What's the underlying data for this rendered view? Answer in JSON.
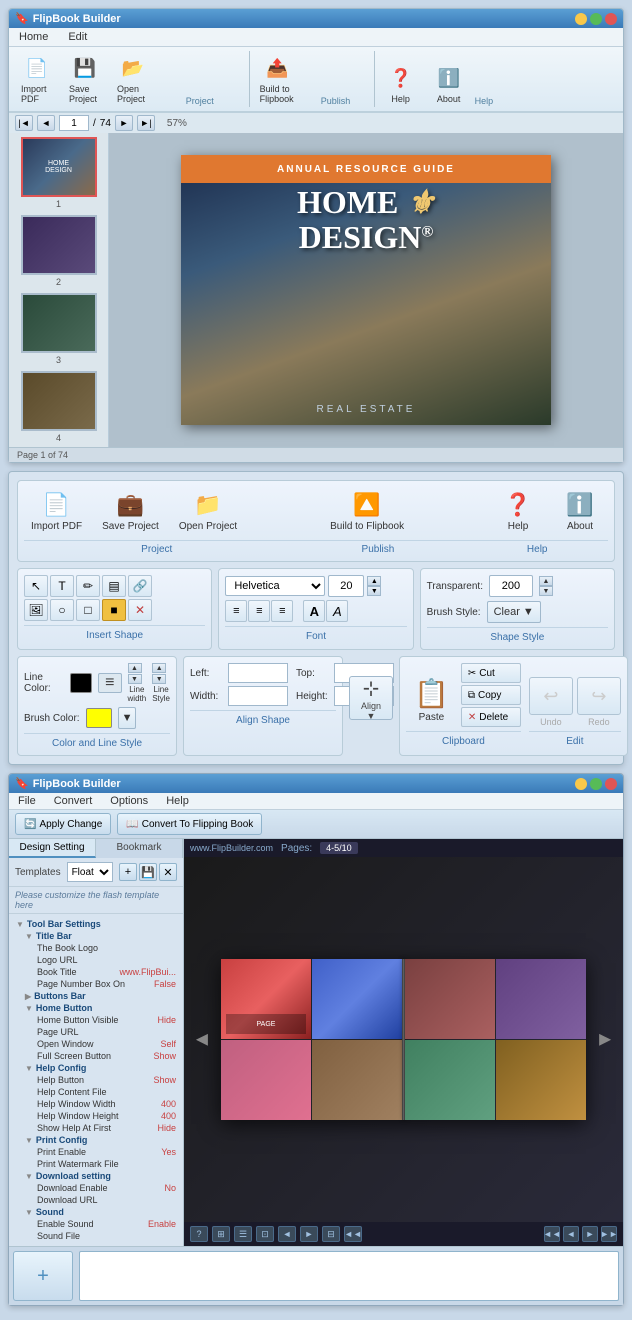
{
  "app": {
    "title": "FlipBook Builder",
    "menus": [
      "Home",
      "Edit"
    ]
  },
  "toolbar": {
    "project": {
      "label": "Project",
      "buttons": [
        {
          "label": "Import PDF",
          "icon": "📄"
        },
        {
          "label": "Save Project",
          "icon": "💾"
        },
        {
          "label": "Open Project",
          "icon": "📂"
        }
      ]
    },
    "publish": {
      "label": "Publish",
      "buttons": [
        {
          "label": "Build to Flipbook",
          "icon": "📤"
        }
      ]
    },
    "help": {
      "label": "Help",
      "buttons": [
        {
          "label": "Help",
          "icon": "❓"
        },
        {
          "label": "About",
          "icon": "ℹ️"
        }
      ]
    }
  },
  "navigation": {
    "current_page": "1",
    "total_pages": "74",
    "status": "Page 1 of 74",
    "zoom": "57%"
  },
  "thumbnails": [
    {
      "num": "1",
      "active": true
    },
    {
      "num": "2",
      "active": false
    },
    {
      "num": "3",
      "active": false
    },
    {
      "num": "4",
      "active": false
    }
  ],
  "cover": {
    "top_bar": "ANNUAL RESOURCE GUIDE",
    "title_line1": "HOME",
    "title_line2": "DESIGN",
    "bottom_text": "REAL ESTATE"
  },
  "section2": {
    "toolbar_groups": {
      "insert_shape": {
        "label": "Insert Shape",
        "tools": [
          "cursor",
          "text",
          "pencil",
          "textbox",
          "link",
          "image",
          "circle",
          "rect",
          "colored-rect",
          "delete-shape"
        ]
      },
      "font": {
        "label": "Font",
        "font_name": "Helvetica",
        "font_size": "20",
        "align_btns": [
          "left",
          "center",
          "right",
          "bold",
          "italic"
        ]
      },
      "shape_style": {
        "label": "Shape Style",
        "transparent_label": "Transparent:",
        "transparent_value": "200",
        "brush_style_label": "Brush Style:",
        "brush_style_value": "Clear"
      }
    },
    "color_style": {
      "label": "Color and Line Style",
      "line_color_label": "Line Color:",
      "brush_color_label": "Brush Color:",
      "line_color": "#000000",
      "brush_color": "#ffff00"
    },
    "align_shape": {
      "label": "Align Shape",
      "left_label": "Left:",
      "top_label": "Top:",
      "width_label": "Width:",
      "height_label": "Height:"
    },
    "clipboard": {
      "label": "Clipboard",
      "paste_label": "Paste",
      "cut_label": "Cut",
      "copy_label": "Copy",
      "delete_label": "Delete"
    },
    "edit": {
      "label": "Edit",
      "undo_label": "Undo",
      "redo_label": "Redo"
    }
  },
  "section3": {
    "title": "FlipBook Builder",
    "menus": [
      "File",
      "Convert",
      "Options",
      "Help"
    ],
    "apply_btn": "Apply Change",
    "convert_btn": "Convert To Flipping Book",
    "tabs": [
      "Design Setting",
      "Bookmark"
    ],
    "templates_label": "Templates",
    "template_value": "Float",
    "customize_text": "Please customize the flash template here",
    "preview_url": "www.FlipBuilder.com",
    "preview_pages": "Pages:",
    "preview_page_num": "4-5/10",
    "tree_items": [
      {
        "label": "Tool Bar Settings",
        "level": 1,
        "expanded": true
      },
      {
        "label": "Title Bar",
        "level": 2,
        "expanded": true
      },
      {
        "label": "The Book Logo",
        "level": 3
      },
      {
        "label": "Logo URL",
        "level": 3
      },
      {
        "label": "Book Title",
        "level": 3,
        "value": "www.FlipBui..."
      },
      {
        "label": "Page Number Box On",
        "level": 3,
        "value": "False"
      },
      {
        "label": "Buttons Bar",
        "level": 2,
        "expanded": false
      },
      {
        "label": "Home Button",
        "level": 2,
        "expanded": true
      },
      {
        "label": "Home Button Visible",
        "level": 3,
        "value": "Hide"
      },
      {
        "label": "Page URL",
        "level": 3
      },
      {
        "label": "Open Window",
        "level": 3,
        "value": "Self"
      },
      {
        "label": "Full Screen Button",
        "level": 3,
        "value": "Show"
      },
      {
        "label": "Help Config",
        "level": 2,
        "expanded": true
      },
      {
        "label": "Help Button",
        "level": 3,
        "value": "Show"
      },
      {
        "label": "Help Content File",
        "level": 3
      },
      {
        "label": "Help Window Width",
        "level": 3,
        "value": "400"
      },
      {
        "label": "Help Window Height",
        "level": 3,
        "value": "400"
      },
      {
        "label": "Show Help At First",
        "level": 3,
        "value": "Hide"
      },
      {
        "label": "Print Config",
        "level": 2,
        "expanded": true
      },
      {
        "label": "Print Enable",
        "level": 3,
        "value": "Yes"
      },
      {
        "label": "Print Watermark File",
        "level": 3
      },
      {
        "label": "Download setting",
        "level": 2,
        "expanded": true
      },
      {
        "label": "Download Enable",
        "level": 3,
        "value": "No"
      },
      {
        "label": "Download URL",
        "level": 3
      },
      {
        "label": "Sound",
        "level": 2,
        "expanded": true
      },
      {
        "label": "Enable Sound",
        "level": 3,
        "value": "Enable"
      },
      {
        "label": "Sound File",
        "level": 3
      }
    ],
    "bottom_tools": [
      "?",
      "⊞",
      "⊟",
      "⊞",
      "◄",
      "►",
      "‖",
      "◄◄"
    ],
    "nav_tools": [
      "◄◄",
      "◄",
      "►",
      "►►"
    ]
  }
}
